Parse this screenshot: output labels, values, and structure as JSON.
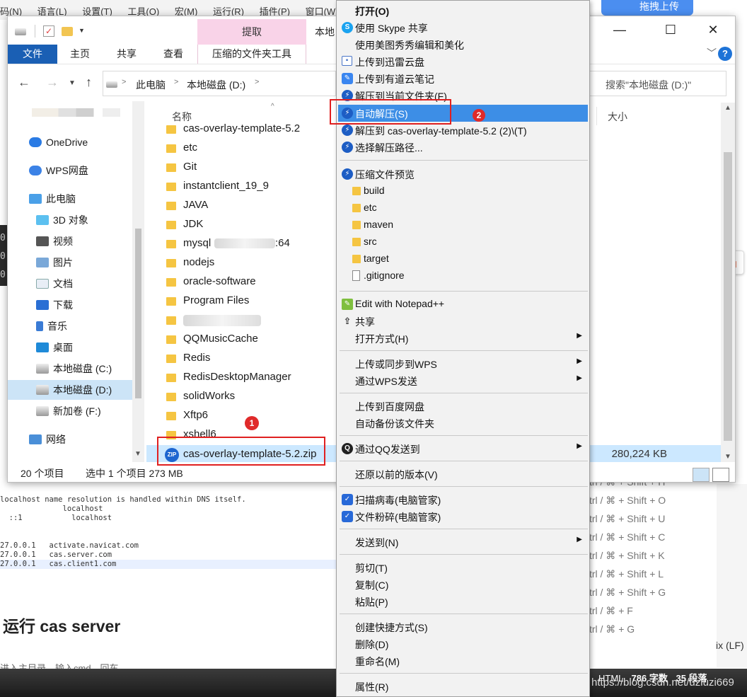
{
  "background": {
    "menubar": [
      "码(N)",
      "语言(L)",
      "设置(T)",
      "工具(O)",
      "宏(M)",
      "运行(R)",
      "插件(P)",
      "窗口(W)"
    ],
    "dark_strip_lines": [
      "0",
      "0",
      "0"
    ],
    "code_lines": [
      "localhost name resolution is handled within DNS itself.",
      "              localhost",
      "  ::1           localhost",
      "",
      "",
      "27.0.0.1   activate.navicat.com",
      "27.0.0.1   cas.server.com",
      "27.0.0.1   cas.client1.com"
    ],
    "heading": "运行 cas server",
    "bottom_text": "进入主目录，输入cmd，回车",
    "status_html": "HTML",
    "status_words": "786 字数",
    "status_paragraphs": "35 段落",
    "watermark": "https://blog.csdn.net/uziuzi669",
    "shortcuts": [
      "trl / ⌘ + Shift + H",
      "trl / ⌘ + Shift + O",
      "trl / ⌘ + Shift + U",
      "trl / ⌘ + Shift + C",
      "trl / ⌘ + Shift + K",
      "trl / ⌘ + Shift + L",
      "trl / ⌘ + Shift + G",
      "trl / ⌘ + F",
      "trl / ⌘ + G"
    ],
    "lf_text": "ix (LF)",
    "upload_label": "拖拽上传",
    "sogou_label": "中"
  },
  "explorer": {
    "ctx_tab_header": "提取",
    "window_title": "本地",
    "ribbon_tabs": [
      "文件",
      "主页",
      "共享",
      "查看",
      "压缩的文件夹工具"
    ],
    "breadcrumb": [
      "此电脑",
      "本地磁盘 (D:)"
    ],
    "search_placeholder": "搜索\"本地磁盘 (D:)\"",
    "column_name": "名称",
    "column_size": "大小",
    "nav_items": [
      {
        "label": "OneDrive",
        "icon": "cloud-icon"
      },
      {
        "label": "WPS网盘",
        "icon": "cloud-icon"
      },
      {
        "label": "此电脑",
        "icon": "computer-icon"
      },
      {
        "label": "3D 对象",
        "icon": "cube-icon"
      },
      {
        "label": "视频",
        "icon": "film-icon"
      },
      {
        "label": "图片",
        "icon": "picture-icon"
      },
      {
        "label": "文档",
        "icon": "document-icon"
      },
      {
        "label": "下载",
        "icon": "download-icon"
      },
      {
        "label": "音乐",
        "icon": "music-icon"
      },
      {
        "label": "桌面",
        "icon": "desktop-icon"
      },
      {
        "label": "本地磁盘 (C:)",
        "icon": "drive-icon"
      },
      {
        "label": "本地磁盘 (D:)",
        "icon": "drive-icon"
      },
      {
        "label": "新加卷 (F:)",
        "icon": "drive-icon"
      },
      {
        "label": "网络",
        "icon": "network-icon"
      }
    ],
    "files": [
      "cas-overlay-template-5.2",
      "etc",
      "Git",
      "instantclient_19_9",
      "JAVA",
      "JDK",
      "mysql",
      "nodejs",
      "oracle-software",
      "Program Files",
      "",
      "QQMusicCache",
      "Redis",
      "RedisDesktopManager",
      "solidWorks",
      "Xftp6",
      "xshell6"
    ],
    "mysql_suffix": ":64",
    "selected_file": "cas-overlay-template-5.2.zip",
    "selected_size": "280,224 KB",
    "status_count": "20 个项目",
    "status_selected": "选中 1 个项目  273 MB"
  },
  "annotations": {
    "badge1": "1",
    "badge2": "2"
  },
  "menu": {
    "items": [
      {
        "label": "打开(O)",
        "icon": "",
        "bold": true
      },
      {
        "label": "使用 Skype 共享",
        "icon": "skype-icon"
      },
      {
        "label": "使用美图秀秀编辑和美化",
        "icon": ""
      },
      {
        "label": "上传到迅雷云盘",
        "icon": "xunlei-icon"
      },
      {
        "label": "上传到有道云笔记",
        "icon": "youdao-icon"
      },
      {
        "label": "解压到当前文件夹(F)",
        "icon": "bandizip-icon"
      },
      {
        "label": "自动解压(S)",
        "icon": "bandizip-icon"
      },
      {
        "label": "解压到 cas-overlay-template-5.2 (2)\\(T)",
        "icon": "bandizip-icon"
      },
      {
        "label": "选择解压路径...",
        "icon": "bandizip-icon"
      },
      {
        "label": "压缩文件预览",
        "icon": "bandizip-icon"
      },
      {
        "label": "build",
        "icon": "folder-icon"
      },
      {
        "label": "etc",
        "icon": "folder-icon"
      },
      {
        "label": "maven",
        "icon": "folder-icon"
      },
      {
        "label": "src",
        "icon": "folder-icon"
      },
      {
        "label": "target",
        "icon": "folder-icon"
      },
      {
        "label": ".gitignore",
        "icon": "file-icon"
      },
      {
        "label": "Edit with Notepad++",
        "icon": "notepad-icon"
      },
      {
        "label": "共享",
        "icon": "share-icon"
      },
      {
        "label": "打开方式(H)",
        "icon": "",
        "submenu": true
      },
      {
        "label": "上传或同步到WPS",
        "icon": "",
        "submenu": true
      },
      {
        "label": "通过WPS发送",
        "icon": "",
        "submenu": true
      },
      {
        "label": "上传到百度网盘",
        "icon": ""
      },
      {
        "label": "自动备份该文件夹",
        "icon": ""
      },
      {
        "label": "通过QQ发送到",
        "icon": "qq-icon",
        "submenu": true
      },
      {
        "label": "还原以前的版本(V)",
        "icon": ""
      },
      {
        "label": "扫描病毒(电脑管家)",
        "icon": "shield-icon"
      },
      {
        "label": "文件粉碎(电脑管家)",
        "icon": "shield-icon"
      },
      {
        "label": "发送到(N)",
        "icon": "",
        "submenu": true
      },
      {
        "label": "剪切(T)",
        "icon": ""
      },
      {
        "label": "复制(C)",
        "icon": ""
      },
      {
        "label": "粘贴(P)",
        "icon": ""
      },
      {
        "label": "创建快捷方式(S)",
        "icon": ""
      },
      {
        "label": "删除(D)",
        "icon": ""
      },
      {
        "label": "重命名(M)",
        "icon": ""
      },
      {
        "label": "属性(R)",
        "icon": ""
      }
    ]
  }
}
